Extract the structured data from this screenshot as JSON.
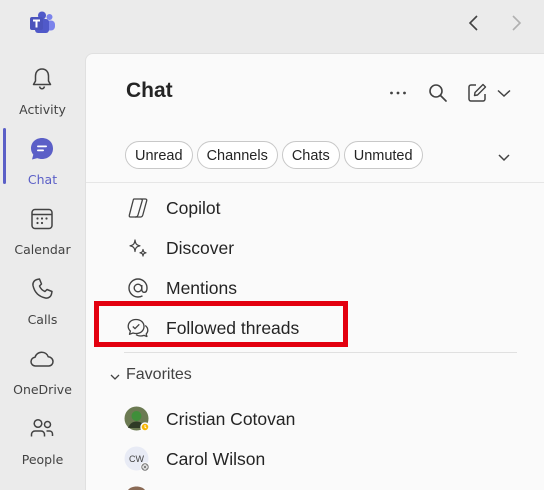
{
  "nav": {
    "back_icon": "chevron-left-icon",
    "forward_icon": "chevron-right-icon"
  },
  "rail": {
    "items": [
      {
        "label": "Activity",
        "icon": "bell-icon"
      },
      {
        "label": "Chat",
        "icon": "chat-icon",
        "active": true
      },
      {
        "label": "Calendar",
        "icon": "calendar-icon"
      },
      {
        "label": "Calls",
        "icon": "phone-icon"
      },
      {
        "label": "OneDrive",
        "icon": "cloud-icon"
      },
      {
        "label": "People",
        "icon": "people-icon"
      }
    ]
  },
  "chat": {
    "title": "Chat",
    "filters": [
      "Unread",
      "Channels",
      "Chats",
      "Unmuted"
    ],
    "items": [
      {
        "label": "Copilot",
        "icon": "copilot-icon"
      },
      {
        "label": "Discover",
        "icon": "sparkle-icon"
      },
      {
        "label": "Mentions",
        "icon": "at-icon"
      },
      {
        "label": "Followed threads",
        "icon": "followed-threads-icon"
      }
    ],
    "favorites": {
      "label": "Favorites",
      "people": [
        {
          "name": "Cristian Cotovan",
          "presence": "away"
        },
        {
          "name": "Carol Wilson",
          "initials": "CW",
          "presence": "offline"
        }
      ]
    }
  },
  "colors": {
    "accent": "#5b5fc7",
    "highlight": "#e3000f"
  }
}
